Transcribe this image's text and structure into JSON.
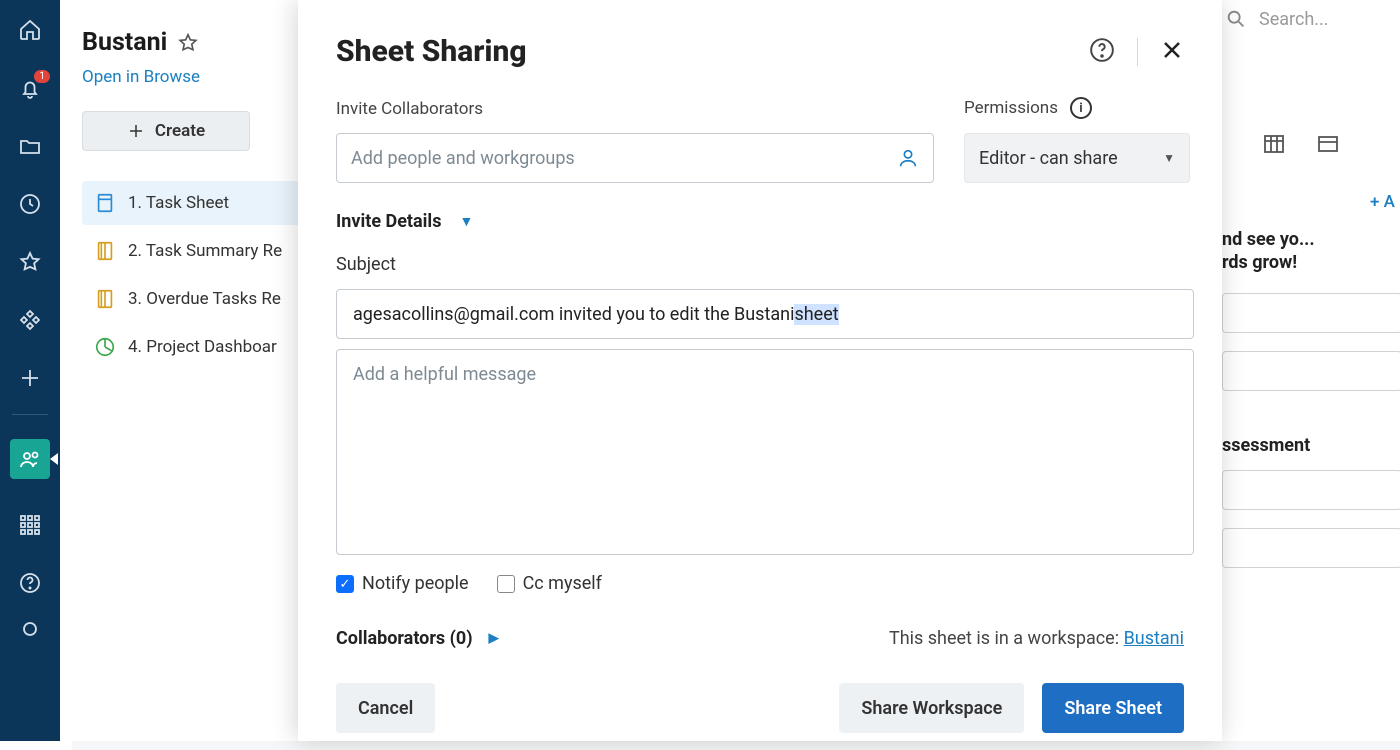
{
  "rail": {
    "notification_count": "1"
  },
  "panel": {
    "title": "Bustani",
    "open_link": "Open in Browse",
    "create_label": "Create",
    "items": [
      {
        "label": "1. Task Sheet"
      },
      {
        "label": "2. Task Summary Re"
      },
      {
        "label": "3. Overdue Tasks Re"
      },
      {
        "label": "4. Project Dashboar"
      }
    ]
  },
  "topbar": {
    "search_placeholder": "Search..."
  },
  "background": {
    "line1": "nd see yo...",
    "line2": "rds grow!",
    "assessment": "ssessment",
    "add_label": "+ A"
  },
  "modal": {
    "title": "Sheet Sharing",
    "invite_label": "Invite Collaborators",
    "people_placeholder": "Add people and workgroups",
    "permissions_label": "Permissions",
    "permissions_value": "Editor - can share",
    "details_label": "Invite Details",
    "subject_label": "Subject",
    "subject_value_prefix": "agesacollins@gmail.com invited you to edit the Bustani ",
    "subject_value_selected": "sheet",
    "message_placeholder": "Add a helpful message",
    "notify_label": "Notify people",
    "cc_label": "Cc myself",
    "collaborators_label": "Collaborators (0)",
    "workspace_text": "This sheet is in a workspace:  ",
    "workspace_link": "Bustani",
    "cancel_label": "Cancel",
    "share_ws_label": "Share Workspace",
    "share_sheet_label": "Share Sheet"
  }
}
